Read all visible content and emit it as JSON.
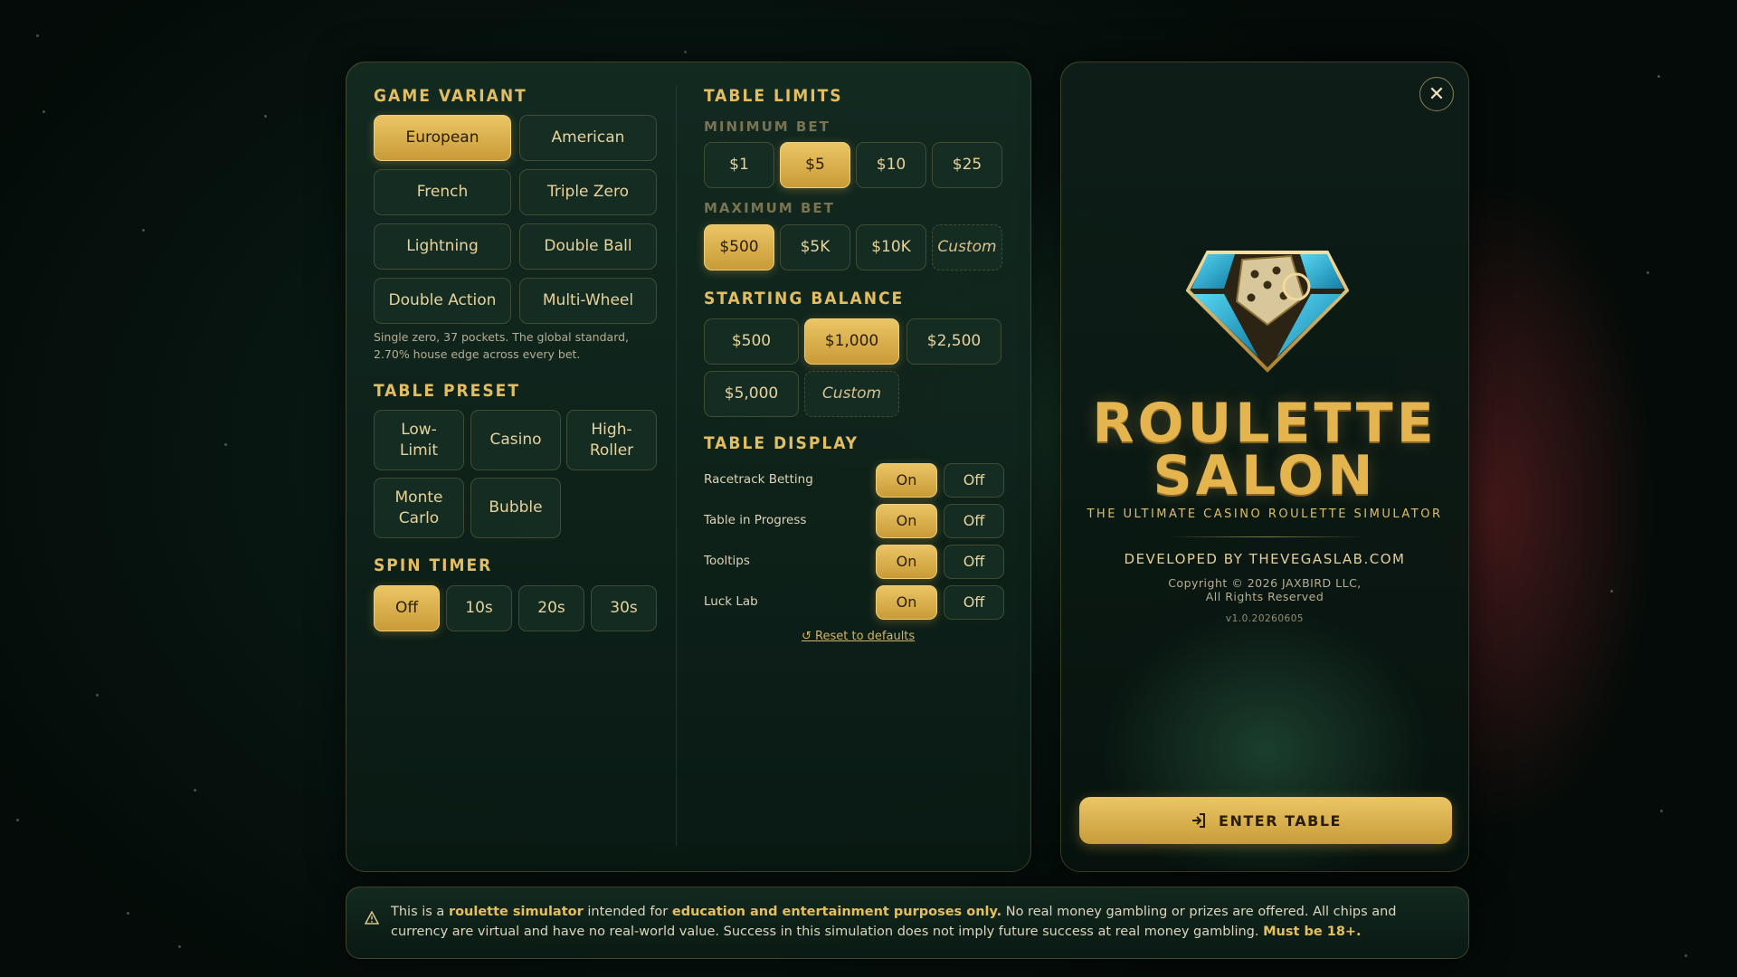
{
  "game_variant": {
    "heading": "GAME VARIANT",
    "options": [
      "European",
      "American",
      "French",
      "Triple Zero",
      "Lightning",
      "Double Ball",
      "Double Action",
      "Multi-Wheel"
    ],
    "selected": "European",
    "description": "Single zero, 37 pockets. The global standard, 2.70% house edge across every bet."
  },
  "table_preset": {
    "heading": "TABLE PRESET",
    "options": [
      "Low-\nLimit",
      "Casino",
      "High-\nRoller",
      "Monte\nCarlo",
      "Bubble"
    ]
  },
  "spin_timer": {
    "heading": "SPIN TIMER",
    "options": [
      "Off",
      "10s",
      "20s",
      "30s"
    ],
    "selected": "Off"
  },
  "table_limits": {
    "heading": "TABLE LIMITS",
    "min_label": "MINIMUM BET",
    "min_options": [
      "$1",
      "$5",
      "$10",
      "$25"
    ],
    "min_selected": "$5",
    "max_label": "MAXIMUM BET",
    "max_options": [
      "$500",
      "$5K",
      "$10K",
      "Custom"
    ],
    "max_selected": "$500"
  },
  "starting_balance": {
    "heading": "STARTING BALANCE",
    "options": [
      "$500",
      "$1,000",
      "$2,500",
      "$5,000",
      "Custom"
    ],
    "selected": "$1,000"
  },
  "table_display": {
    "heading": "TABLE DISPLAY",
    "on_label": "On",
    "off_label": "Off",
    "rows": [
      {
        "label": "Racetrack Betting",
        "value": "On"
      },
      {
        "label": "Table in Progress",
        "value": "On"
      },
      {
        "label": "Tooltips",
        "value": "On"
      },
      {
        "label": "Luck Lab",
        "value": "On"
      }
    ],
    "reset": "↺ Reset to defaults"
  },
  "brand": {
    "title_line1": "ROULETTE",
    "title_line2": "SALON",
    "tagline": "THE ULTIMATE CASINO ROULETTE SIMULATOR",
    "developer": "DEVELOPED BY THEVEGASLAB.COM",
    "copyright_line1": "Copyright © 2026 JAXBIRD LLC,",
    "copyright_line2": "All Rights Reserved",
    "version": "v1.0.20260605",
    "enter_label": "ENTER TABLE",
    "close_icon": "close-icon",
    "logo_icon": "diamond-dice-logo"
  },
  "notice": {
    "t1": "This is a ",
    "h1": "roulette simulator",
    "t2": " intended for ",
    "h2": "education and entertainment purposes only.",
    "t3": " No real money gambling or prizes are offered. All chips and currency are virtual and have no real-world value. Success in this simulation does not imply future success at real money gambling. ",
    "h3": "Must be 18+.",
    "icon": "warning-icon"
  },
  "colors": {
    "accent": "#e2bd62",
    "selected": "#d9ae4c",
    "background": "#071410"
  }
}
